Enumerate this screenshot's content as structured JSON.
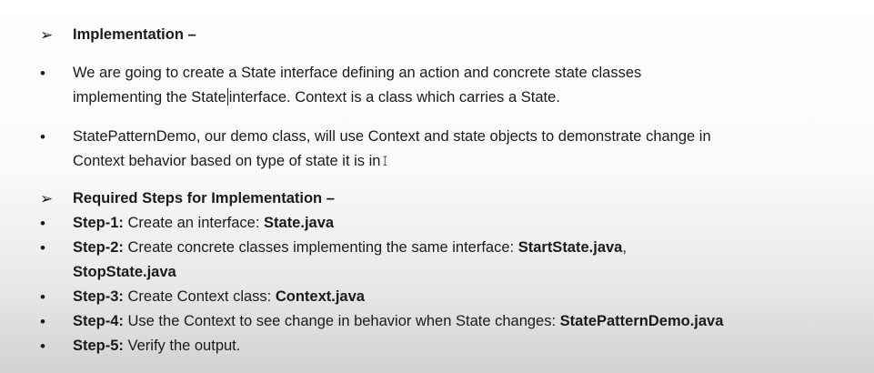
{
  "sections": {
    "implementation": {
      "marker": "➢",
      "heading": "Implementation –"
    },
    "intro_bullets": [
      {
        "marker": "•",
        "line1_a": "We are going to create a State interface defining an action and concrete state classes",
        "line2_a": "implementing the State",
        "line2_b": "interface. Context is a class which carries a State."
      },
      {
        "marker": "•",
        "line1": "StatePatternDemo, our demo class, will use Context and state objects to demonstrate change in",
        "line2": "Context behavior based on type of state it is in"
      }
    ],
    "required_steps": {
      "marker": "➢",
      "heading": "Required Steps for Implementation –"
    },
    "steps": [
      {
        "marker": "•",
        "label": "Step-1:",
        "text": " Create an interface: ",
        "file": "State.java"
      },
      {
        "marker": "•",
        "label": "Step-2:",
        "text": " Create concrete classes implementing the same interface: ",
        "file": "StartState.java",
        "trail": ",",
        "file2": "StopState.java"
      },
      {
        "marker": "•",
        "label": "Step-3:",
        "text": " Create Context class: ",
        "file": "Context.java"
      },
      {
        "marker": "•",
        "label": "Step-4:",
        "text": " Use the Context to see change in behavior when State changes: ",
        "file": "StatePatternDemo.java"
      },
      {
        "marker": "•",
        "label": "Step-5:",
        "text": " Verify the output."
      }
    ]
  }
}
